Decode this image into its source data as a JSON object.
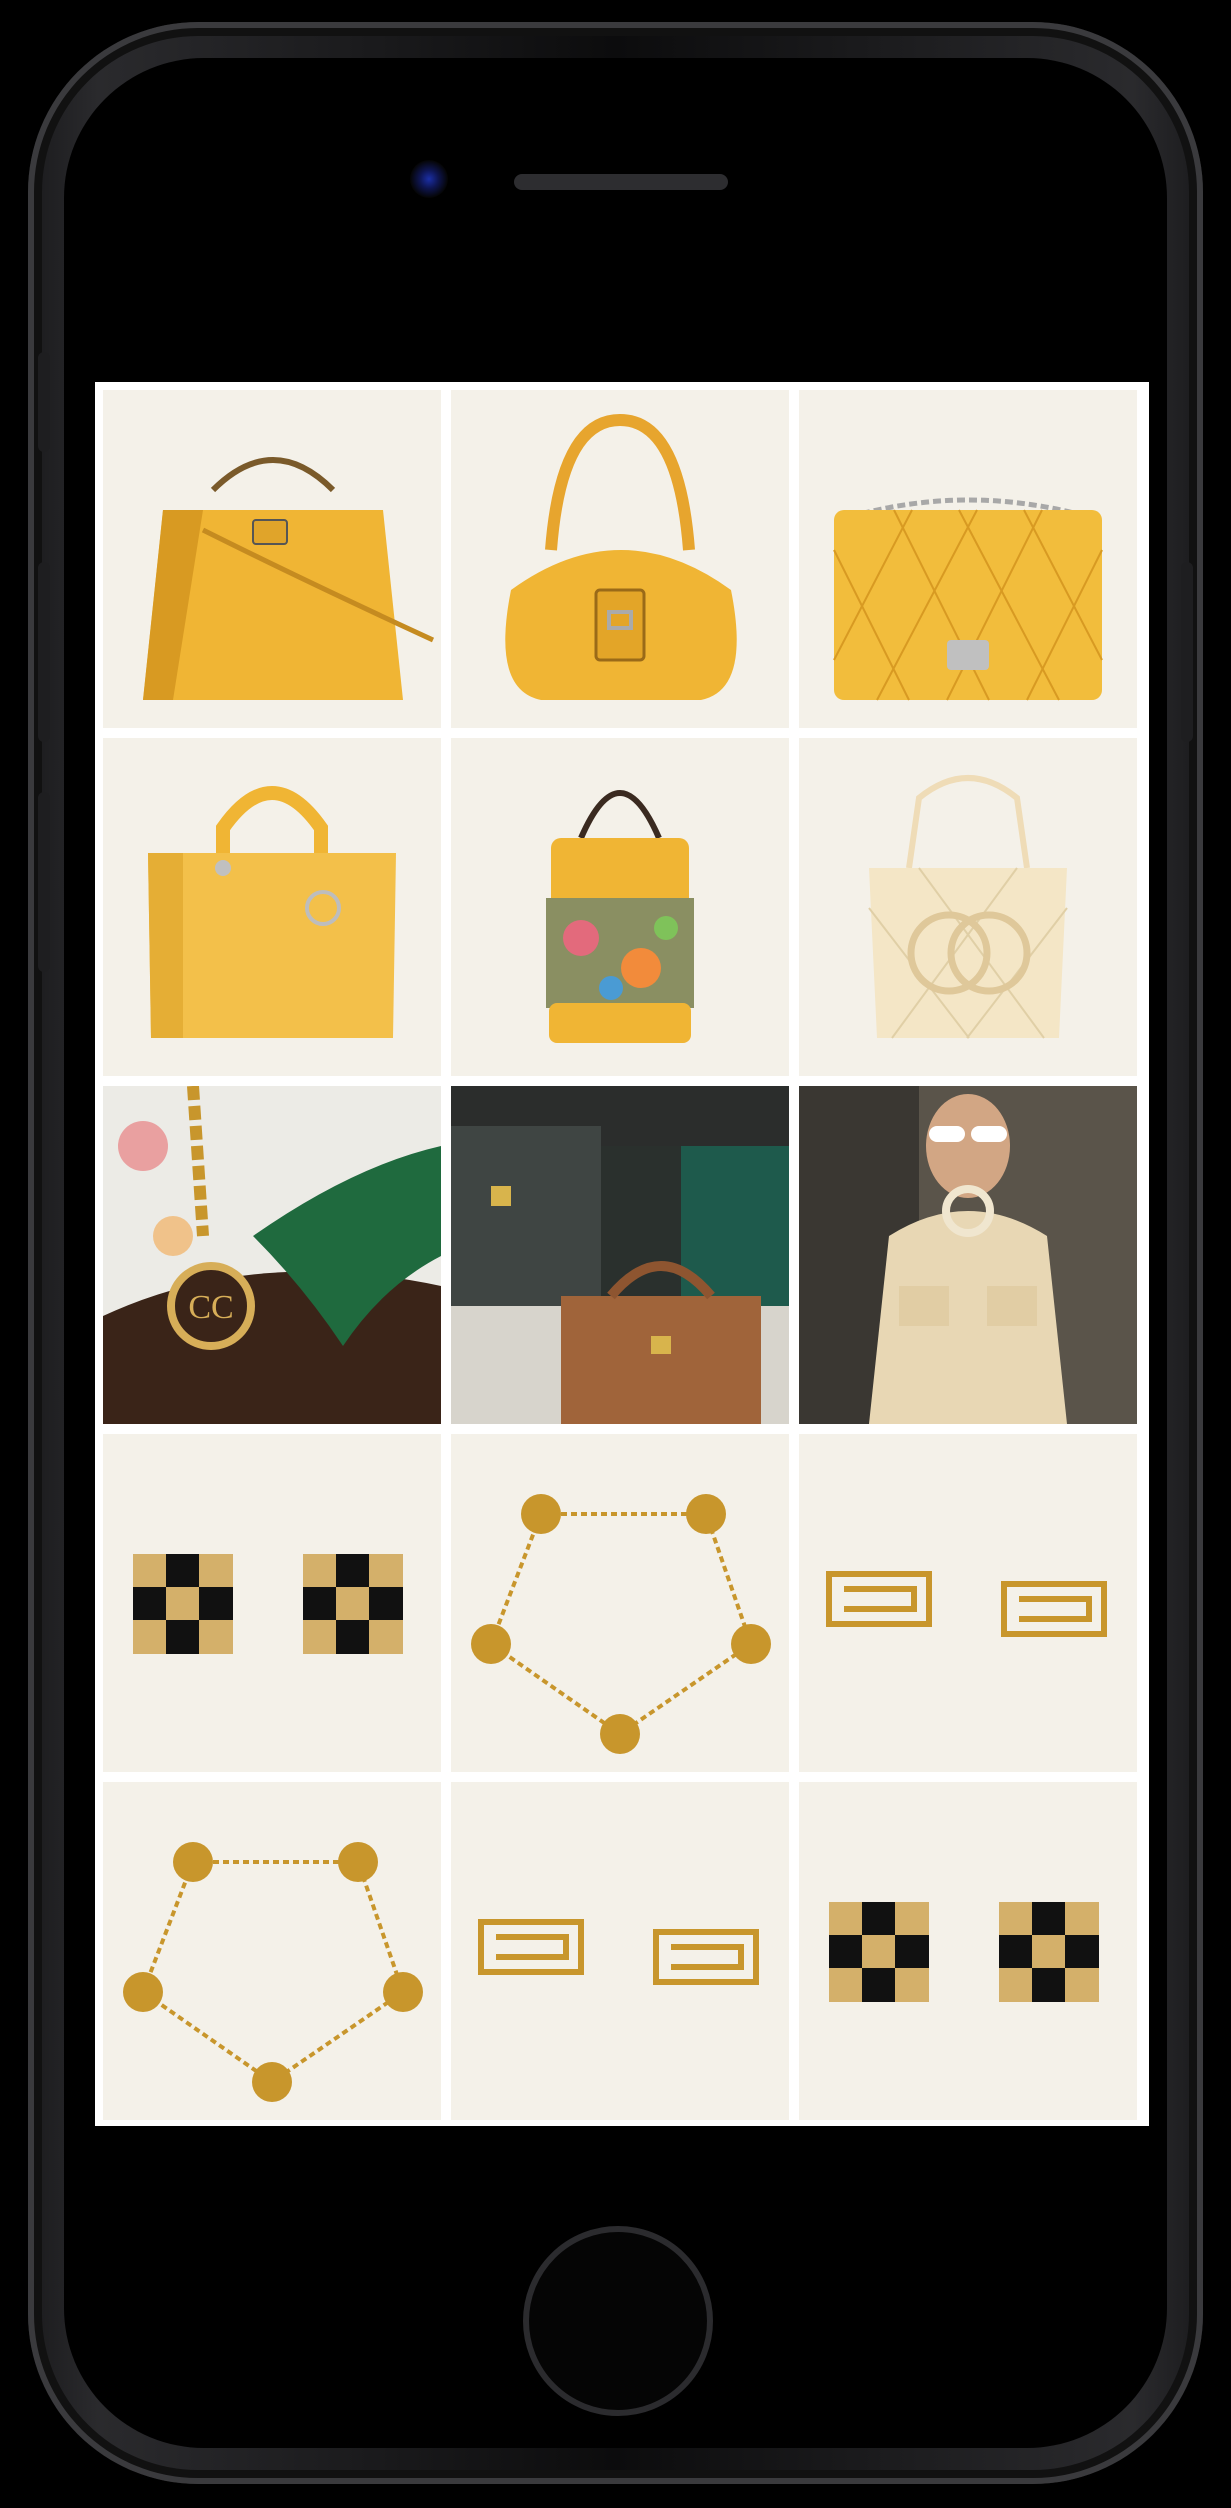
{
  "device": {
    "model": "iphone-like"
  },
  "grid": {
    "items": [
      {
        "icon": "yellow-structured-handbag-icon"
      },
      {
        "icon": "yellow-hobo-bag-icon"
      },
      {
        "icon": "yellow-quilted-flap-bag-icon"
      },
      {
        "icon": "yellow-tote-bag-icon"
      },
      {
        "icon": "floral-bucket-bag-icon"
      },
      {
        "icon": "cream-quilted-tote-icon"
      },
      {
        "icon": "green-glove-pendant-photo-icon"
      },
      {
        "icon": "dark-handbags-collection-photo-icon"
      },
      {
        "icon": "model-cream-jacket-photo-icon"
      },
      {
        "icon": "checkered-earrings-icon"
      },
      {
        "icon": "clover-bracelet-icon"
      },
      {
        "icon": "logo-earrings-icon"
      },
      {
        "icon": "clover-bracelet-icon"
      },
      {
        "icon": "logo-earrings-icon"
      },
      {
        "icon": "checkered-earrings-icon"
      }
    ]
  },
  "colors": {
    "tile_background": "#f4f1e9",
    "bag_yellow": "#f0b534",
    "gold": "#c8962c",
    "dark_green": "#1f6a3e"
  }
}
